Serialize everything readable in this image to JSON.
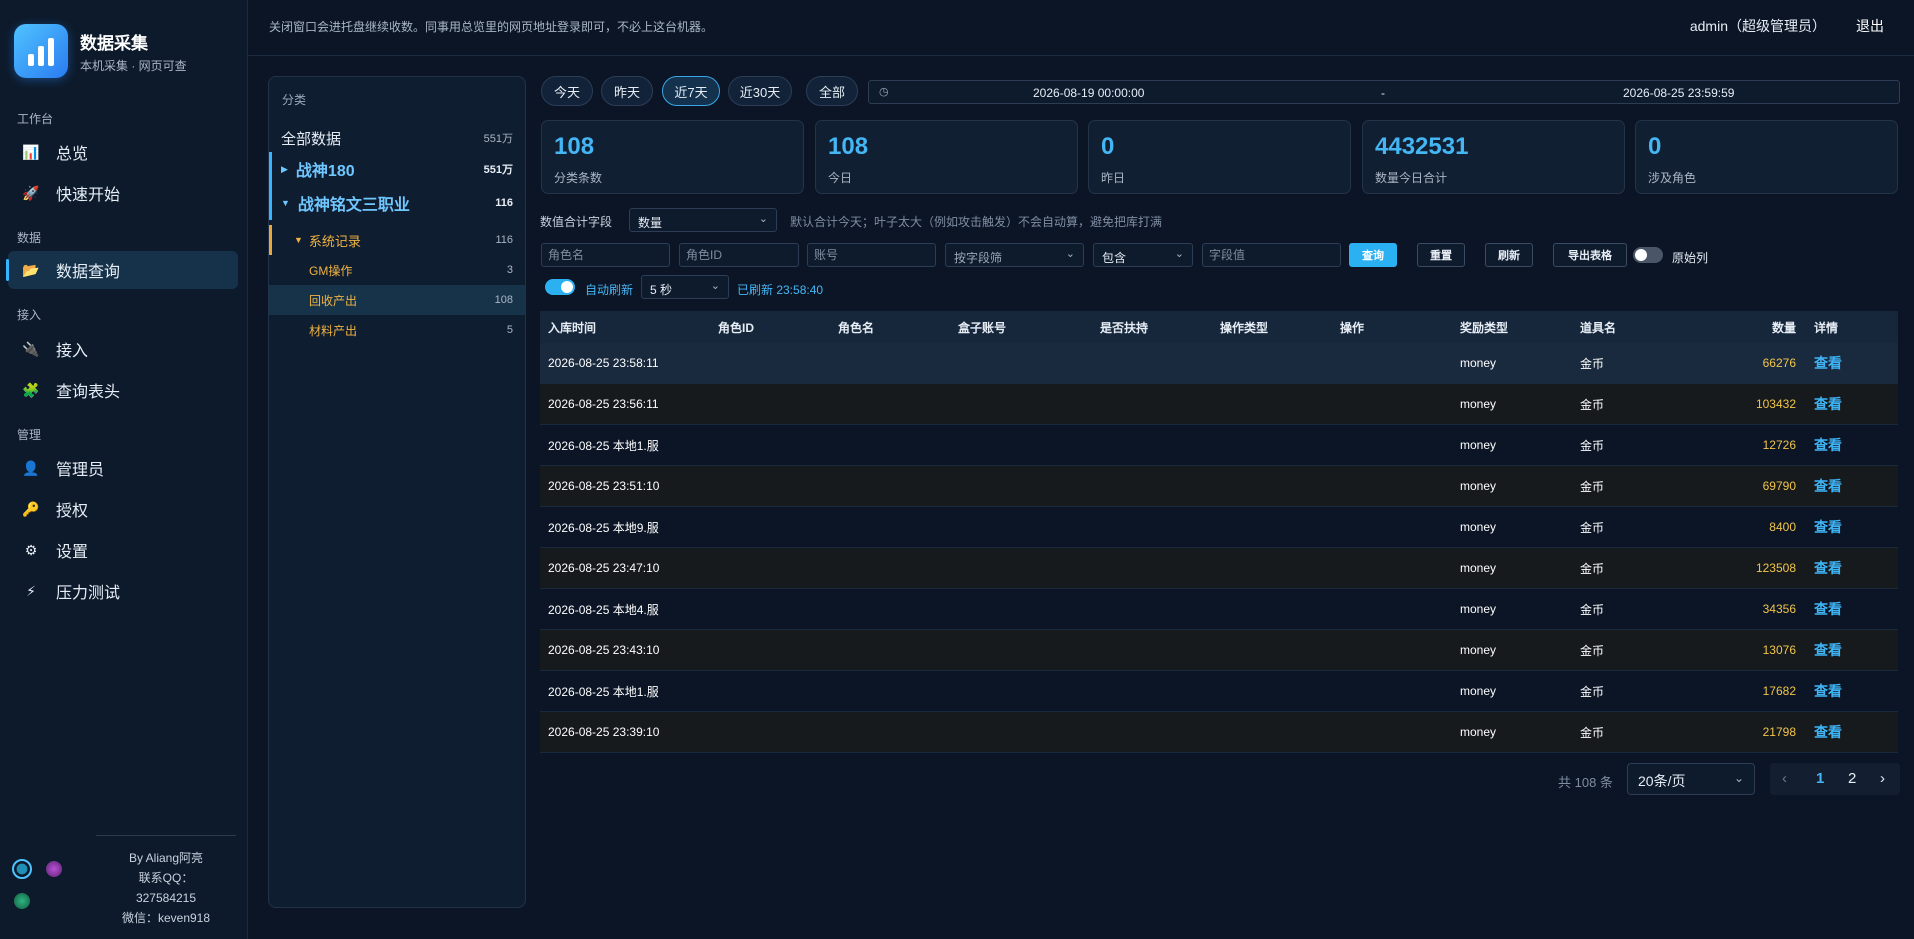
{
  "brand": {
    "title": "数据采集",
    "subtitle": "本机采集 · 网页可查"
  },
  "nav": {
    "groups": [
      "工作台",
      "数据",
      "接入",
      "管理"
    ],
    "items": [
      {
        "label": "总览",
        "icon": "bar-chart-icon"
      },
      {
        "label": "快速开始",
        "icon": "rocket-icon"
      },
      {
        "label": "数据查询",
        "icon": "folder-icon"
      },
      {
        "label": "接入",
        "icon": "plug-icon"
      },
      {
        "label": "查询表头",
        "icon": "puzzle-icon"
      },
      {
        "label": "管理员",
        "icon": "user-icon"
      },
      {
        "label": "授权",
        "icon": "key-icon"
      },
      {
        "label": "设置",
        "icon": "gear-icon"
      },
      {
        "label": "压力测试",
        "icon": "lightning-icon"
      }
    ]
  },
  "author": {
    "by": "By Aliang阿亮",
    "qq_label": "联系QQ：",
    "qq": "327584215",
    "wechat": "微信：keven918"
  },
  "header": {
    "notice": "关闭窗口会进托盘继续收数。同事用总览里的网页地址登录即可，不必上这台机器。",
    "user": "admin（超级管理员）",
    "logout": "退出"
  },
  "categories": {
    "head": "分类",
    "all": {
      "label": "全部数据",
      "count": "551万"
    },
    "games": [
      {
        "label": "战神180",
        "count": "551万"
      },
      {
        "label": "战神铭文三职业",
        "count": "116"
      }
    ],
    "system": {
      "label": "系统记录",
      "count": "116"
    },
    "leaves": [
      {
        "label": "GM操作",
        "count": "3"
      },
      {
        "label": "回收产出",
        "count": "108"
      },
      {
        "label": "材料产出",
        "count": "5"
      }
    ]
  },
  "quick_ranges": [
    "今天",
    "昨天",
    "近7天",
    "近30天",
    "全部"
  ],
  "daterange": {
    "start": "2026-08-19 00:00:00",
    "sep": "-",
    "end": "2026-08-25 23:59:59"
  },
  "stats": [
    {
      "value": "108",
      "label": "分类条数"
    },
    {
      "value": "108",
      "label": "今日"
    },
    {
      "value": "0",
      "label": "昨日"
    },
    {
      "value": "4432531",
      "label": "数量今日合计"
    },
    {
      "value": "0",
      "label": "涉及角色"
    }
  ],
  "sum": {
    "label": "数值合计字段",
    "value": "数量",
    "hint": "默认合计今天；叶子太大（例如攻击触发）不会自动算，避免把库打满"
  },
  "filters": {
    "role_name": "角色名",
    "role_id": "角色ID",
    "account": "账号",
    "field_filter": "按字段筛",
    "match": "包含",
    "field_value": "字段值",
    "query": "查询",
    "reset": "重置",
    "refresh": "刷新",
    "export": "导出表格",
    "raw": "原始列"
  },
  "auto": {
    "label": "自动刷新",
    "interval": "5 秒",
    "status": "已刷新 23:58:40"
  },
  "table": {
    "headers": [
      "入库时间",
      "角色ID",
      "角色名",
      "盒子账号",
      "是否扶持",
      "操作类型",
      "操作",
      "奖励类型",
      "道具名",
      "数量",
      "详情"
    ],
    "rows": [
      {
        "time": "2026-08-25 23:58:11",
        "type": "money",
        "item": "金币",
        "qty": "66276",
        "detail": "查看"
      },
      {
        "time": "2026-08-25 23:56:11",
        "type": "money",
        "item": "金币",
        "qty": "103432",
        "detail": "查看"
      },
      {
        "time": "2026-08-25 本地1.服",
        "type": "money",
        "item": "金币",
        "qty": "12726",
        "detail": "查看"
      },
      {
        "time": "2026-08-25 23:51:10",
        "type": "money",
        "item": "金币",
        "qty": "69790",
        "detail": "查看"
      },
      {
        "time": "2026-08-25 本地9.服",
        "type": "money",
        "item": "金币",
        "qty": "8400",
        "detail": "查看"
      },
      {
        "time": "2026-08-25 23:47:10",
        "type": "money",
        "item": "金币",
        "qty": "123508",
        "detail": "查看"
      },
      {
        "time": "2026-08-25 本地4.服",
        "type": "money",
        "item": "金币",
        "qty": "34356",
        "detail": "查看"
      },
      {
        "time": "2026-08-25 23:43:10",
        "type": "money",
        "item": "金币",
        "qty": "13076",
        "detail": "查看"
      },
      {
        "time": "2026-08-25 本地1.服",
        "type": "money",
        "item": "金币",
        "qty": "17682",
        "detail": "查看"
      },
      {
        "time": "2026-08-25 23:39:10",
        "type": "money",
        "item": "金币",
        "qty": "21798",
        "detail": "查看"
      }
    ]
  },
  "pagination": {
    "total": "共 108 条",
    "page_size": "20条/页",
    "prev": "‹",
    "next": "›",
    "pages": [
      "1",
      "2"
    ]
  },
  "colors": {
    "accent": "#37b6ff",
    "highlight": "#f0b341",
    "quantity": "#f1c54a",
    "bg": "#0b1526"
  }
}
